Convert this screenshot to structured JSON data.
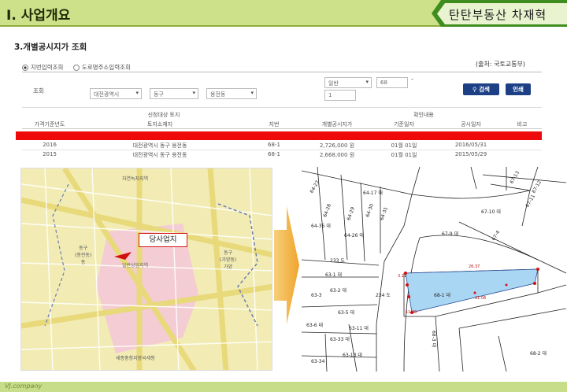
{
  "header": {
    "title": "Ⅰ. 사업개요",
    "brand": "탄탄부동산 차재혁"
  },
  "section_title": "3.개별공시지가 조회",
  "source_note": "(출처: 국토교통부)",
  "search": {
    "radio_1": "지번입력조회",
    "radio_2": "도로명주소입력조회",
    "label": "조회",
    "city": "대전광역시",
    "district": "동구",
    "dong": "용전동",
    "land_type": "일반",
    "main_no": "68",
    "dash": "-",
    "sub_no": "1",
    "search_btn": "검색",
    "print_btn": "인쇄"
  },
  "table": {
    "group_left": "신청대상 토지",
    "group_right": "확인내용",
    "headers": [
      "가격기준년도",
      "토지소재지",
      "지번",
      "개별공시지가",
      "기준일자",
      "공시일자",
      "비고"
    ],
    "rows": [
      [
        "2016",
        "대전광역시 동구 용전동",
        "68-1",
        "2,726,000 원",
        "01월 01일",
        "2016/05/31",
        ""
      ],
      [
        "2015",
        "대전광역시 동구 용전동",
        "68-1",
        "2,668,000 원",
        "01월 01일",
        "2015/05/29",
        ""
      ]
    ]
  },
  "location_map": {
    "callout": "당사업지",
    "labels": {
      "north": "자연녹지지역",
      "district_left": "동구\n(용전동)\n동",
      "district_right": "동구\n(가양동)\n가양",
      "site": "일반상업지역",
      "bottom": "세종충청지방국세청"
    }
  },
  "cadastral": {
    "parcels": [
      "64-27",
      "64-17 대",
      "64-28",
      "64-35 대",
      "64-29",
      "64-26 대",
      "64-30",
      "64-31",
      "67-13",
      "67-12",
      "67-11",
      "67-10 대",
      "67-9 대",
      "67-4",
      "233 도",
      "63-1 대",
      "63-2 대",
      "234 도",
      "68-1 대",
      "63-3",
      "63-5 대",
      "63-6 대",
      "63-11 대",
      "63-33 대",
      "63-13 대",
      "63-34",
      "68-3 대",
      "68-2 대"
    ],
    "dims": [
      "26.37",
      "3.11",
      "11.98",
      "21.06"
    ]
  },
  "footer": "VJ.company"
}
